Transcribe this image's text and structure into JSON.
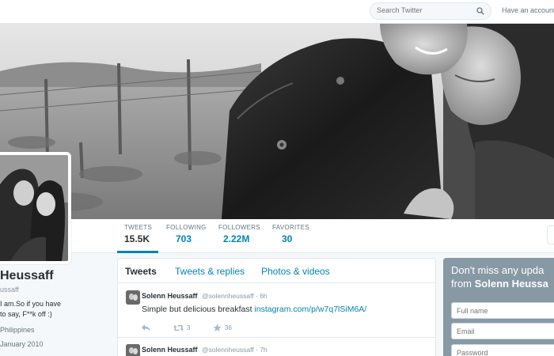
{
  "topbar": {
    "search_placeholder": "Search Twitter",
    "have_account": "Have an account?"
  },
  "nav": {
    "stats": [
      {
        "label": "TWEETS",
        "value": "15.5K"
      },
      {
        "label": "FOLLOWING",
        "value": "703"
      },
      {
        "label": "FOLLOWERS",
        "value": "2.22M"
      },
      {
        "label": "FAVORITES",
        "value": "30"
      }
    ]
  },
  "profile": {
    "name": "Heussaff",
    "handle": "ussaff",
    "bio_line1": "I am.So if you have",
    "bio_line2": "to say, F**k off :)",
    "location": "Philippines",
    "joined": "January 2010"
  },
  "timeline": {
    "tabs": [
      "Tweets",
      "Tweets & replies",
      "Photos & videos"
    ],
    "tweets": [
      {
        "name": "Solenn Heussaff",
        "handle_time": "@solennheussaff · 6h",
        "text": "Simple but delicious breakfast ",
        "link": "instagram.com/p/w7q7lSiM6A/",
        "retweets": "3",
        "favorites": "36"
      },
      {
        "name": "Solenn Heussaff",
        "handle_time": "@solennheussaff · 7h"
      }
    ]
  },
  "signup": {
    "line1": "Don't miss any upda",
    "line2_prefix": "from ",
    "line2_name": "Solenn Heussa",
    "fields": [
      "Full name",
      "Email",
      "Password"
    ]
  },
  "colors": {
    "accent": "#0084b4",
    "page_bg": "#f5f8fa",
    "signup_bg": "#8899a6"
  },
  "icons": [
    "search-icon",
    "reply-icon",
    "retweet-icon",
    "favorite-icon"
  ]
}
